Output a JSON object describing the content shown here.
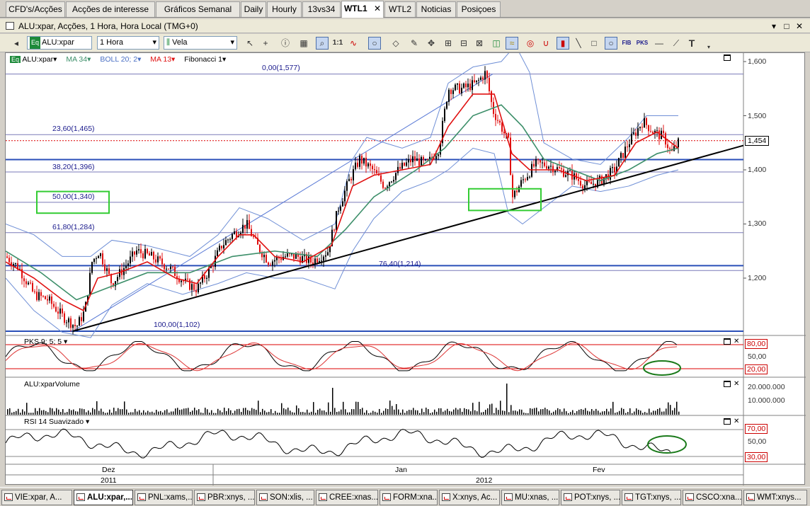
{
  "tabs": [
    "CFD's/Acções",
    "Acções de interesse",
    "Gráficos Semanal",
    "Daily",
    "Hourly",
    "13vs34",
    "WTL1",
    "WTL2",
    "Noticias",
    "Posiçoes"
  ],
  "active_tab": "WTL1",
  "window": {
    "title": "ALU:xpar, Acções, 1 Hora, Hora Local (TMG+0)",
    "controls": [
      "▾",
      "□",
      "✕"
    ]
  },
  "toolbar": {
    "symbol_value": "ALU:xpar",
    "interval_value": "1 Hora",
    "chart_type_value": "Vela",
    "buttons": [
      "arrow",
      "crosshair",
      "info",
      "grid",
      "zoom",
      "1:1",
      "indicator",
      "circle",
      "eraser",
      "pencil",
      "move",
      "tool-a",
      "tool-b",
      "tool-c",
      "magnet",
      "redraw",
      "bars",
      "line",
      "rect",
      "ellipse",
      "FIB",
      "PKS",
      "hline",
      "trend",
      "text"
    ]
  },
  "legend": {
    "symbol": "ALU:xpar",
    "ma": "MA 34",
    "boll": "BOLL 20; 2",
    "ma2": "MA 13",
    "fib": "Fibonacci 1"
  },
  "colors": {
    "ma34": "#3d8f6a",
    "ma13": "#e01010",
    "boll": "#6f8fd6",
    "fib": "#1a1a8c",
    "up": "#000000",
    "down": "#e01010",
    "highlight": "#33cc33"
  },
  "chart_data": {
    "type": "candlestick",
    "price_axis": [
      "1,600",
      "1,500",
      "1,400",
      "1,300",
      "1,200"
    ],
    "ylim": [
      1.09,
      1.62
    ],
    "current_price": "1,454",
    "fibonacci_levels": [
      {
        "label": "0,00(1,577)",
        "value": 1.577
      },
      {
        "label": "23,60(1,465)",
        "value": 1.465
      },
      {
        "label": "38,20(1,396)",
        "value": 1.396
      },
      {
        "label": "50,00(1,340)",
        "value": 1.34
      },
      {
        "label": "61,80(1,284)",
        "value": 1.284
      },
      {
        "label": "76,40(1,214)",
        "value": 1.214
      },
      {
        "label": "100,00(1,102)",
        "value": 1.102
      }
    ],
    "horizontal_lines": [
      1.419,
      1.223
    ],
    "series_path": [
      [
        0,
        1.24
      ],
      [
        18,
        1.22
      ],
      [
        40,
        1.17
      ],
      [
        60,
        1.16
      ],
      [
        80,
        1.13
      ],
      [
        100,
        1.11
      ],
      [
        112,
        1.14
      ],
      [
        122,
        1.23
      ],
      [
        132,
        1.25
      ],
      [
        150,
        1.19
      ],
      [
        168,
        1.22
      ],
      [
        185,
        1.25
      ],
      [
        205,
        1.24
      ],
      [
        230,
        1.22
      ],
      [
        255,
        1.19
      ],
      [
        270,
        1.18
      ],
      [
        290,
        1.22
      ],
      [
        305,
        1.26
      ],
      [
        320,
        1.28
      ],
      [
        340,
        1.3
      ],
      [
        355,
        1.26
      ],
      [
        372,
        1.23
      ],
      [
        392,
        1.24
      ],
      [
        412,
        1.24
      ],
      [
        432,
        1.23
      ],
      [
        455,
        1.25
      ],
      [
        470,
        1.33
      ],
      [
        485,
        1.38
      ],
      [
        500,
        1.42
      ],
      [
        518,
        1.4
      ],
      [
        535,
        1.37
      ],
      [
        555,
        1.4
      ],
      [
        575,
        1.42
      ],
      [
        595,
        1.41
      ],
      [
        612,
        1.44
      ],
      [
        625,
        1.55
      ],
      [
        645,
        1.55
      ],
      [
        665,
        1.56
      ],
      [
        678,
        1.58
      ],
      [
        688,
        1.51
      ],
      [
        700,
        1.48
      ],
      [
        710,
        1.45
      ],
      [
        716,
        1.35
      ],
      [
        730,
        1.38
      ],
      [
        748,
        1.41
      ],
      [
        765,
        1.41
      ],
      [
        782,
        1.4
      ],
      [
        800,
        1.39
      ],
      [
        820,
        1.37
      ],
      [
        840,
        1.38
      ],
      [
        860,
        1.4
      ],
      [
        880,
        1.45
      ],
      [
        900,
        1.49
      ],
      [
        915,
        1.47
      ],
      [
        930,
        1.46
      ],
      [
        940,
        1.43
      ],
      [
        950,
        1.45
      ]
    ],
    "ma13_path": [
      [
        0,
        1.23
      ],
      [
        40,
        1.2
      ],
      [
        80,
        1.16
      ],
      [
        110,
        1.14
      ],
      [
        130,
        1.2
      ],
      [
        160,
        1.21
      ],
      [
        200,
        1.23
      ],
      [
        240,
        1.2
      ],
      [
        270,
        1.19
      ],
      [
        300,
        1.24
      ],
      [
        330,
        1.28
      ],
      [
        350,
        1.28
      ],
      [
        380,
        1.24
      ],
      [
        420,
        1.23
      ],
      [
        460,
        1.26
      ],
      [
        490,
        1.37
      ],
      [
        520,
        1.39
      ],
      [
        560,
        1.4
      ],
      [
        600,
        1.41
      ],
      [
        625,
        1.48
      ],
      [
        660,
        1.54
      ],
      [
        690,
        1.54
      ],
      [
        715,
        1.43
      ],
      [
        740,
        1.4
      ],
      [
        780,
        1.4
      ],
      [
        820,
        1.38
      ],
      [
        860,
        1.39
      ],
      [
        890,
        1.45
      ],
      [
        920,
        1.47
      ],
      [
        950,
        1.44
      ]
    ],
    "ma34_path": [
      [
        0,
        1.25
      ],
      [
        50,
        1.21
      ],
      [
        100,
        1.16
      ],
      [
        140,
        1.18
      ],
      [
        200,
        1.21
      ],
      [
        260,
        1.21
      ],
      [
        320,
        1.24
      ],
      [
        380,
        1.25
      ],
      [
        440,
        1.24
      ],
      [
        480,
        1.29
      ],
      [
        520,
        1.35
      ],
      [
        580,
        1.4
      ],
      [
        620,
        1.44
      ],
      [
        660,
        1.5
      ],
      [
        700,
        1.52
      ],
      [
        730,
        1.48
      ],
      [
        760,
        1.42
      ],
      [
        800,
        1.4
      ],
      [
        840,
        1.38
      ],
      [
        880,
        1.4
      ],
      [
        920,
        1.43
      ],
      [
        950,
        1.44
      ]
    ],
    "boll_upper_path": [
      [
        0,
        1.3
      ],
      [
        40,
        1.28
      ],
      [
        80,
        1.24
      ],
      [
        120,
        1.24
      ],
      [
        150,
        1.27
      ],
      [
        200,
        1.26
      ],
      [
        260,
        1.24
      ],
      [
        300,
        1.28
      ],
      [
        330,
        1.33
      ],
      [
        370,
        1.31
      ],
      [
        420,
        1.27
      ],
      [
        465,
        1.3
      ],
      [
        490,
        1.42
      ],
      [
        510,
        1.46
      ],
      [
        560,
        1.44
      ],
      [
        600,
        1.46
      ],
      [
        625,
        1.56
      ],
      [
        660,
        1.59
      ],
      [
        700,
        1.6
      ],
      [
        720,
        1.63
      ],
      [
        740,
        1.58
      ],
      [
        760,
        1.45
      ],
      [
        800,
        1.42
      ],
      [
        840,
        1.41
      ],
      [
        880,
        1.46
      ],
      [
        905,
        1.5
      ],
      [
        950,
        1.5
      ]
    ],
    "boll_lower_path": [
      [
        0,
        1.2
      ],
      [
        40,
        1.14
      ],
      [
        80,
        1.1
      ],
      [
        120,
        1.09
      ],
      [
        150,
        1.15
      ],
      [
        200,
        1.19
      ],
      [
        250,
        1.17
      ],
      [
        300,
        1.19
      ],
      [
        340,
        1.21
      ],
      [
        380,
        1.2
      ],
      [
        420,
        1.2
      ],
      [
        465,
        1.18
      ],
      [
        490,
        1.25
      ],
      [
        520,
        1.31
      ],
      [
        560,
        1.36
      ],
      [
        600,
        1.38
      ],
      [
        625,
        1.4
      ],
      [
        660,
        1.44
      ],
      [
        690,
        1.43
      ],
      [
        710,
        1.32
      ],
      [
        730,
        1.3
      ],
      [
        760,
        1.33
      ],
      [
        800,
        1.37
      ],
      [
        840,
        1.36
      ],
      [
        880,
        1.37
      ],
      [
        920,
        1.39
      ],
      [
        950,
        1.4
      ]
    ],
    "trendline": [
      [
        95,
        1.102
      ],
      [
        1042,
        1.445
      ]
    ],
    "fan_line": [
      [
        95,
        1.102
      ],
      [
        688,
        1.577
      ]
    ],
    "green_boxes": [
      {
        "x1": 44,
        "x2": 146,
        "y1": 1.32,
        "y2": 1.36
      },
      {
        "x1": 654,
        "x2": 756,
        "y1": 1.325,
        "y2": 1.365
      }
    ],
    "x_labels_top": [
      {
        "label": "Dez",
        "x": 145
      },
      {
        "label": "Jan",
        "x": 558
      },
      {
        "label": "Fev",
        "x": 837
      }
    ],
    "x_labels_bottom": [
      {
        "label": "2011",
        "x": 145
      },
      {
        "label": "2012",
        "x": 676
      }
    ]
  },
  "pks_panel": {
    "title": "PKS 9; 5; 5",
    "levels": [
      "80,00",
      "50,00",
      "20,00"
    ]
  },
  "volume_panel": {
    "title": "ALU:xparVolume",
    "levels": [
      "20.000.000",
      "10.000.000"
    ]
  },
  "rsi_panel": {
    "title": "RSI 14 Suavizado",
    "levels": [
      "70,00",
      "50,00",
      "30,00"
    ]
  },
  "taskbar": [
    "VIE:xpar, A...",
    "ALU:xpar,...",
    "PNL:xams,...",
    "PBR:xnys, ...",
    "SON:xlis, ...",
    "CREE:xnas...",
    "FORM:xna...",
    "X:xnys, Ac...",
    "MU:xnas, ...",
    "POT:xnys, ...",
    "TGT:xnys, ...",
    "CSCO:xna...",
    "WMT:xnys..."
  ],
  "taskbar_active": 1
}
